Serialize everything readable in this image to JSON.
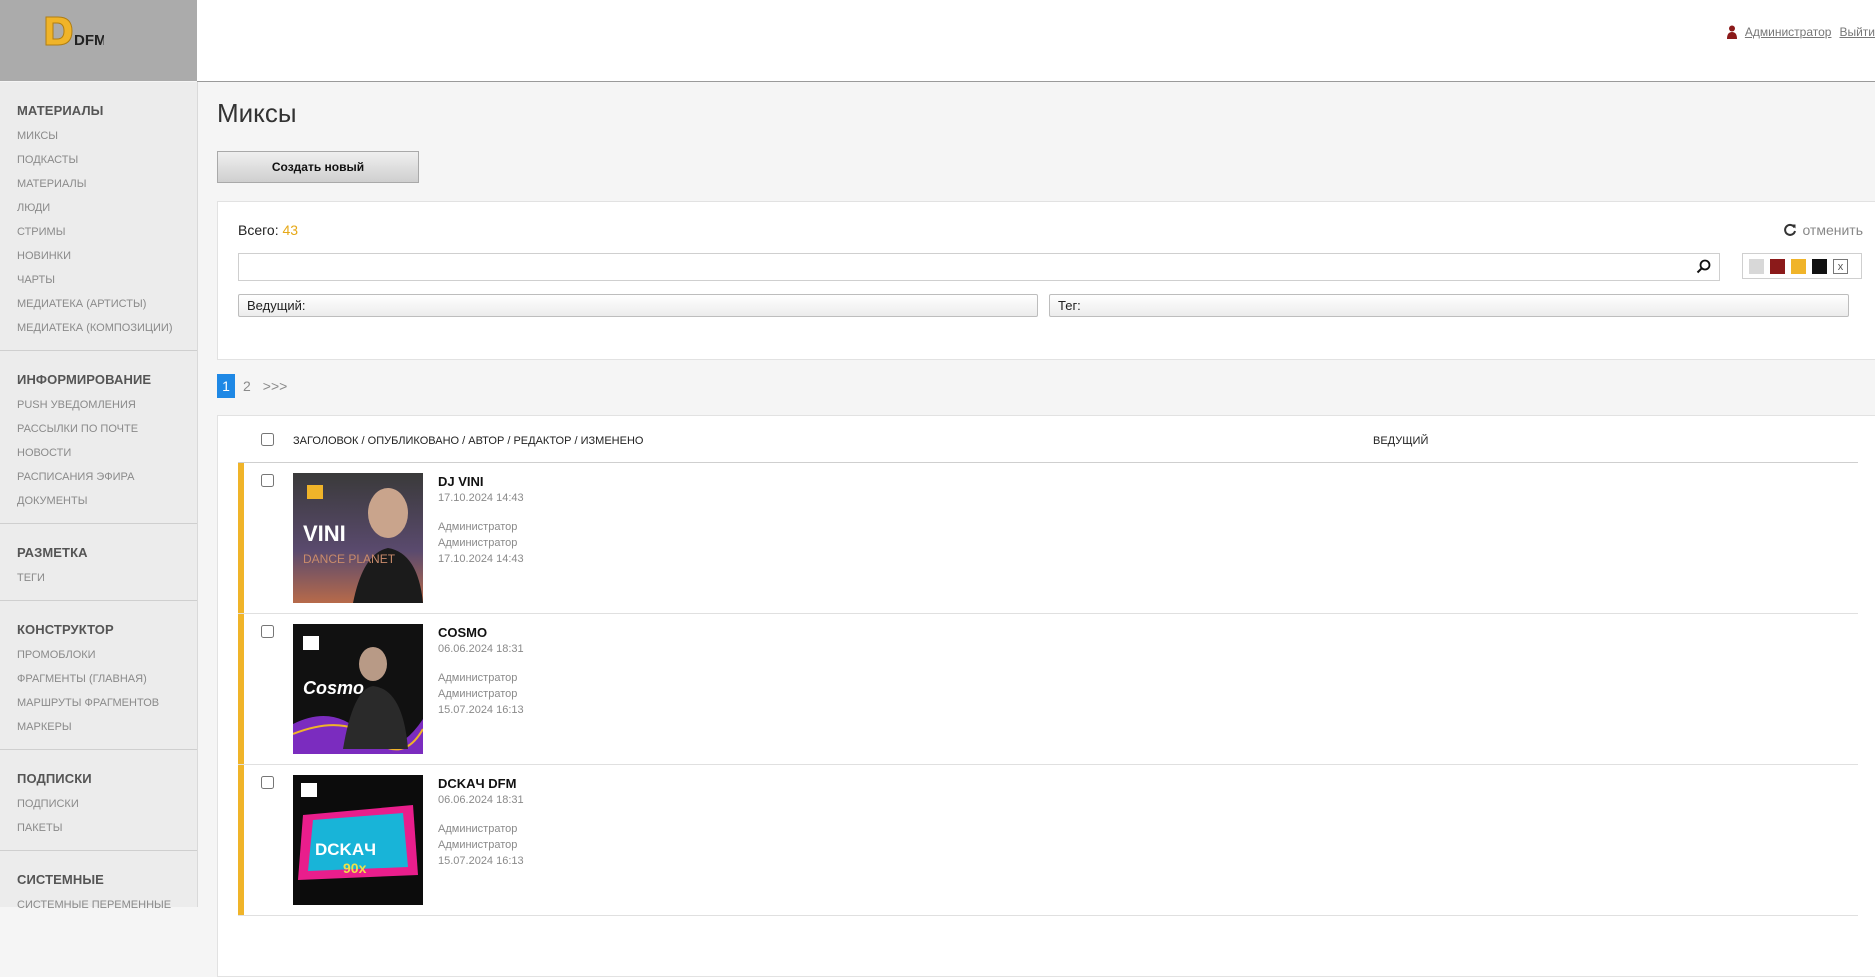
{
  "header": {
    "logo_text": "DFM",
    "user_name": "Администратор",
    "logout_label": "Выйти"
  },
  "sidebar": {
    "sections": [
      {
        "title": "МАТЕРИАЛЫ",
        "items": [
          "МИКСЫ",
          "ПОДКАСТЫ",
          "МАТЕРИАЛЫ",
          "ЛЮДИ",
          "СТРИМЫ",
          "НОВИНКИ",
          "ЧАРТЫ",
          "МЕДИАТЕКА (АРТИСТЫ)",
          "МЕДИАТЕКА (КОМПОЗИЦИИ)"
        ]
      },
      {
        "title": "ИНФОРМИРОВАНИЕ",
        "items": [
          "PUSH УВЕДОМЛЕНИЯ",
          "РАССЫЛКИ ПО ПОЧТЕ",
          "НОВОСТИ",
          "РАСПИСАНИЯ ЭФИРА",
          "ДОКУМЕНТЫ"
        ]
      },
      {
        "title": "РАЗМЕТКА",
        "items": [
          "ТЕГИ"
        ]
      },
      {
        "title": "КОНСТРУКТОР",
        "items": [
          "ПРОМОБЛОКИ",
          "ФРАГМЕНТЫ (ГЛАВНАЯ)",
          "МАРШРУТЫ ФРАГМЕНТОВ",
          "МАРКЕРЫ"
        ]
      },
      {
        "title": "ПОДПИСКИ",
        "items": [
          "ПОДПИСКИ",
          "ПАКЕТЫ"
        ]
      },
      {
        "title": "СИСТЕМНЫЕ",
        "items": [
          "СИСТЕМНЫЕ ПЕРЕМЕННЫЕ"
        ]
      }
    ]
  },
  "main": {
    "title": "Миксы",
    "create_label": "Создать новый"
  },
  "filters": {
    "total_label": "Всего:",
    "total_count": "43",
    "reset_label": "отменить",
    "search_value": "",
    "swatch_colors": [
      "#d8d8d8",
      "#8b1a1a",
      "#f0b429",
      "#111111"
    ],
    "swatch_clear": "x",
    "presenter_label": "Ведущий:",
    "tag_label": "Тег:"
  },
  "pagination": {
    "current": "1",
    "pages": [
      "2"
    ],
    "next": ">>>"
  },
  "list": {
    "head_title": "ЗАГОЛОВОК / ОПУБЛИКОВАНО / АВТОР / РЕДАКТОР / ИЗМЕНЕНО",
    "head_presenter": "ВЕДУЩИЙ",
    "accent_color": "#f0b429",
    "rows": [
      {
        "title": "DJ VINI",
        "published": "17.10.2024 14:43",
        "author": "Администратор",
        "editor": "Администратор",
        "modified": "17.10.2024 14:43",
        "thumb_text": "VINI",
        "thumb_sub": "DANCE PLANET"
      },
      {
        "title": "COSMO",
        "published": "06.06.2024 18:31",
        "author": "Администратор",
        "editor": "Администратор",
        "modified": "15.07.2024 16:13",
        "thumb_text": "Cosmo"
      },
      {
        "title": "DCKAЧ DFM",
        "published": "06.06.2024 18:31",
        "author": "Администратор",
        "editor": "Администратор",
        "modified": "15.07.2024 16:13",
        "thumb_text": "DCKAЧ",
        "thumb_sub": "90x"
      }
    ]
  }
}
